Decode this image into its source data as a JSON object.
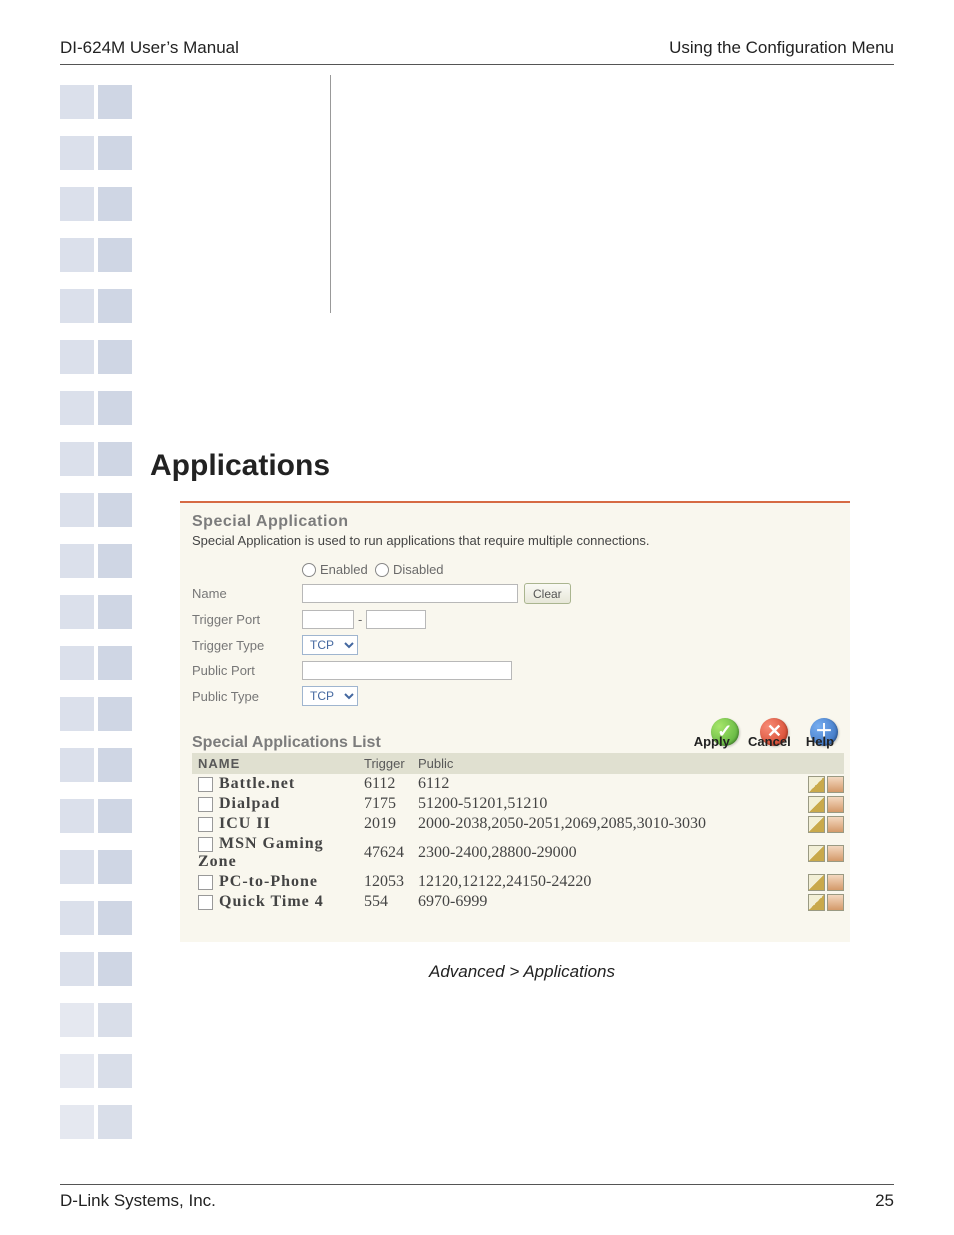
{
  "header": {
    "left": "DI-624M User’s Manual",
    "right": "Using the Configuration Menu"
  },
  "section_title": "Applications",
  "panel": {
    "title": "Special Application",
    "desc": "Special Application is used to run applications that require multiple connections.",
    "enabled_label": "Enabled",
    "disabled_label": "Disabled",
    "labels": {
      "name": "Name",
      "trigger_port": "Trigger Port",
      "trigger_type": "Trigger Type",
      "public_port": "Public Port",
      "public_type": "Public Type"
    },
    "clear_btn": "Clear",
    "trigger_type_value": "TCP",
    "public_type_value": "TCP",
    "dash": "-",
    "actions": {
      "apply": "Apply",
      "cancel": "Cancel",
      "help": "Help"
    },
    "list_title": "Special Applications List",
    "list_header": {
      "name": "NAME",
      "trigger": "Trigger",
      "public": "Public"
    },
    "rows": [
      {
        "name": "Battle.net",
        "trigger": "6112",
        "public": "6112"
      },
      {
        "name": "Dialpad",
        "trigger": "7175",
        "public": "51200-51201,51210"
      },
      {
        "name": "ICU II",
        "trigger": "2019",
        "public": "2000-2038,2050-2051,2069,2085,3010-3030"
      },
      {
        "name": "MSN Gaming Zone",
        "trigger": "47624",
        "public": "2300-2400,28800-29000"
      },
      {
        "name": "PC-to-Phone",
        "trigger": "12053",
        "public": "12120,12122,24150-24220"
      },
      {
        "name": "Quick Time 4",
        "trigger": "554",
        "public": "6970-6999"
      }
    ]
  },
  "caption": "Advanced > Applications",
  "footer": {
    "left": "D-Link Systems, Inc.",
    "right": "25"
  }
}
